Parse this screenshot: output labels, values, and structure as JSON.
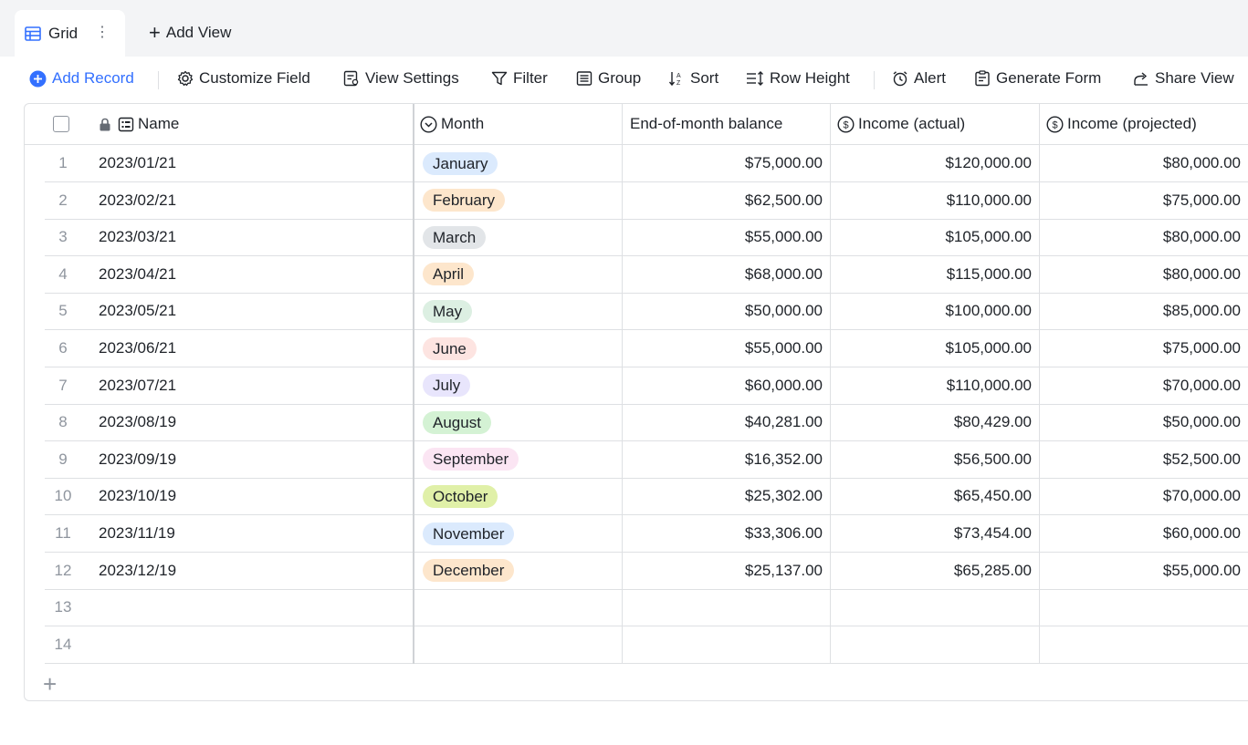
{
  "tabs": {
    "active_view": "Grid",
    "add_view": "Add View"
  },
  "toolbar": {
    "add_record": "Add Record",
    "customize_field": "Customize Field",
    "view_settings": "View Settings",
    "filter": "Filter",
    "group": "Group",
    "sort": "Sort",
    "row_height": "Row Height",
    "alert": "Alert",
    "generate_form": "Generate Form",
    "share_view": "Share View"
  },
  "columns": {
    "name": "Name",
    "month": "Month",
    "balance": "End-of-month balance",
    "income_actual": "Income (actual)",
    "income_projected": "Income (projected)"
  },
  "colors": {
    "accent": "#3370ff",
    "tag_colors": [
      "#dbeafd",
      "#fde6cc",
      "#e2e5e8",
      "#fde6cc",
      "#dcefe2",
      "#fde4e1",
      "#e8e5fc",
      "#d4f2d4",
      "#fbe5f3",
      "#e0f0a8",
      "#dbeafd",
      "#fde6cc"
    ]
  },
  "rows": [
    {
      "num": "1",
      "name": "2023/01/21",
      "month": "January",
      "balance": "$75,000.00",
      "income_actual": "$120,000.00",
      "income_projected": "$80,000.00"
    },
    {
      "num": "2",
      "name": "2023/02/21",
      "month": "February",
      "balance": "$62,500.00",
      "income_actual": "$110,000.00",
      "income_projected": "$75,000.00"
    },
    {
      "num": "3",
      "name": "2023/03/21",
      "month": "March",
      "balance": "$55,000.00",
      "income_actual": "$105,000.00",
      "income_projected": "$80,000.00"
    },
    {
      "num": "4",
      "name": "2023/04/21",
      "month": "April",
      "balance": "$68,000.00",
      "income_actual": "$115,000.00",
      "income_projected": "$80,000.00"
    },
    {
      "num": "5",
      "name": "2023/05/21",
      "month": "May",
      "balance": "$50,000.00",
      "income_actual": "$100,000.00",
      "income_projected": "$85,000.00"
    },
    {
      "num": "6",
      "name": "2023/06/21",
      "month": "June",
      "balance": "$55,000.00",
      "income_actual": "$105,000.00",
      "income_projected": "$75,000.00"
    },
    {
      "num": "7",
      "name": "2023/07/21",
      "month": "July",
      "balance": "$60,000.00",
      "income_actual": "$110,000.00",
      "income_projected": "$70,000.00"
    },
    {
      "num": "8",
      "name": "2023/08/19",
      "month": "August",
      "balance": "$40,281.00",
      "income_actual": "$80,429.00",
      "income_projected": "$50,000.00"
    },
    {
      "num": "9",
      "name": "2023/09/19",
      "month": "September",
      "balance": "$16,352.00",
      "income_actual": "$56,500.00",
      "income_projected": "$52,500.00"
    },
    {
      "num": "10",
      "name": "2023/10/19",
      "month": "October",
      "balance": "$25,302.00",
      "income_actual": "$65,450.00",
      "income_projected": "$70,000.00"
    },
    {
      "num": "11",
      "name": "2023/11/19",
      "month": "November",
      "balance": "$33,306.00",
      "income_actual": "$73,454.00",
      "income_projected": "$60,000.00"
    },
    {
      "num": "12",
      "name": "2023/12/19",
      "month": "December",
      "balance": "$25,137.00",
      "income_actual": "$65,285.00",
      "income_projected": "$55,000.00"
    },
    {
      "num": "13",
      "name": "",
      "month": "",
      "balance": "",
      "income_actual": "",
      "income_projected": ""
    },
    {
      "num": "14",
      "name": "",
      "month": "",
      "balance": "",
      "income_actual": "",
      "income_projected": ""
    }
  ],
  "add_row_icon": "plus-icon"
}
